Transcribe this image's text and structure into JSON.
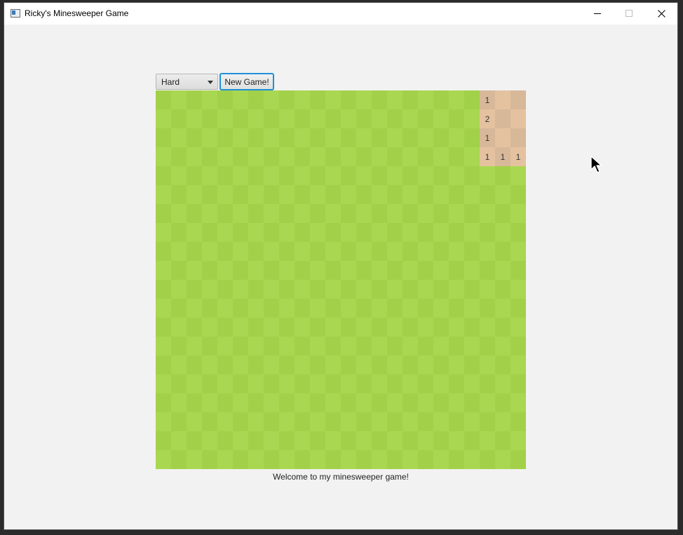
{
  "window": {
    "title": "Ricky's Minesweeper Game"
  },
  "controls": {
    "difficulty": {
      "selected": "Hard"
    },
    "new_game_label": "New Game!"
  },
  "board": {
    "rows": 20,
    "cols": 24,
    "revealed": [
      {
        "row": 0,
        "col": 21,
        "value": "1"
      },
      {
        "row": 0,
        "col": 22,
        "value": ""
      },
      {
        "row": 0,
        "col": 23,
        "value": ""
      },
      {
        "row": 1,
        "col": 21,
        "value": "2"
      },
      {
        "row": 1,
        "col": 22,
        "value": ""
      },
      {
        "row": 1,
        "col": 23,
        "value": ""
      },
      {
        "row": 2,
        "col": 21,
        "value": "1"
      },
      {
        "row": 2,
        "col": 22,
        "value": ""
      },
      {
        "row": 2,
        "col": 23,
        "value": ""
      },
      {
        "row": 3,
        "col": 21,
        "value": "1"
      },
      {
        "row": 3,
        "col": 22,
        "value": "1"
      },
      {
        "row": 3,
        "col": 23,
        "value": "1"
      }
    ],
    "colors": {
      "grass_light": "#a9d751",
      "grass_dark": "#a2d149",
      "dirt_light": "#e5c29f",
      "dirt_dark": "#d7b899"
    }
  },
  "status": {
    "message": "Welcome to my minesweeper game!"
  }
}
